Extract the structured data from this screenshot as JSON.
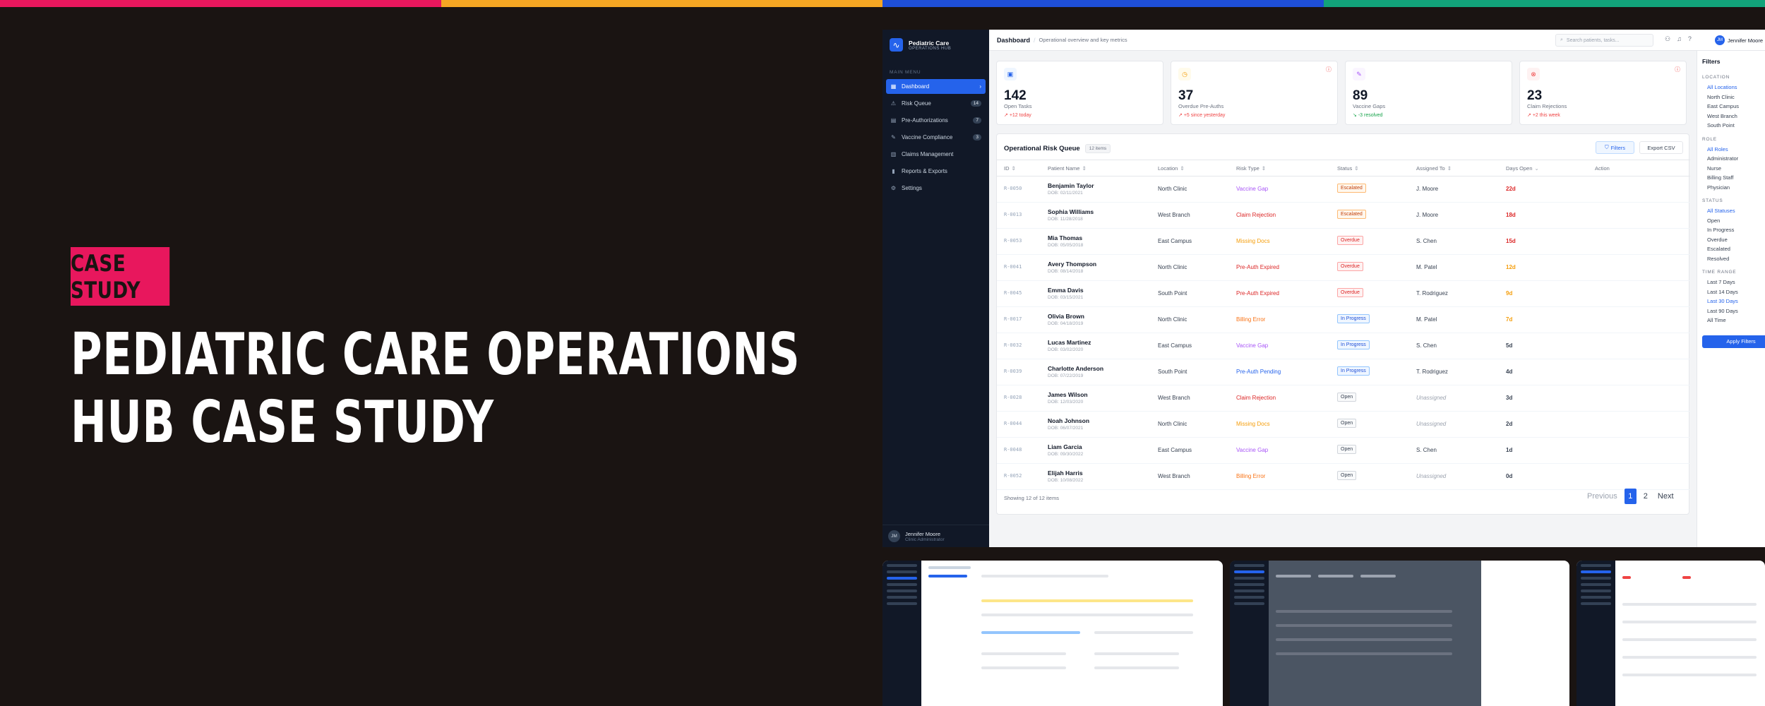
{
  "colors": {
    "stripe1": "#e8175d",
    "stripe2": "#f5a623",
    "stripe3": "#1e4fd8",
    "stripe4": "#12a37a",
    "accent": "#2563eb",
    "bg": "#1a1412"
  },
  "hero": {
    "badge": "CASE STUDY",
    "title_line1": "PEDIATRIC CARE OPERATIONS",
    "title_line2": "HUB CASE STUDY"
  },
  "app": {
    "brand": {
      "name": "Pediatric Care",
      "sub": "OPERATIONS HUB",
      "icon": "pulse-icon"
    },
    "menu_label": "MAIN MENU",
    "nav": [
      {
        "label": "Dashboard",
        "icon": "grid-icon",
        "active": true,
        "count": ""
      },
      {
        "label": "Risk Queue",
        "icon": "warning-icon",
        "active": false,
        "count": "14"
      },
      {
        "label": "Pre-Authorizations",
        "icon": "document-icon",
        "active": false,
        "count": "7"
      },
      {
        "label": "Vaccine Compliance",
        "icon": "syringe-icon",
        "active": false,
        "count": "3"
      },
      {
        "label": "Claims Management",
        "icon": "receipt-icon",
        "active": false,
        "count": ""
      },
      {
        "label": "Reports & Exports",
        "icon": "chart-icon",
        "active": false,
        "count": ""
      },
      {
        "label": "Settings",
        "icon": "gear-icon",
        "active": false,
        "count": ""
      }
    ],
    "user": {
      "initials": "JM",
      "name": "Jennifer Moore",
      "role": "Clinic Administrator"
    },
    "topbar": {
      "title": "Dashboard",
      "subtitle": "Operational overview and key metrics",
      "search_placeholder": "Search patients, tasks...",
      "user_initials": "JM",
      "user_name": "Jennifer Moore"
    },
    "kpis": [
      {
        "value": "142",
        "label": "Open Tasks",
        "delta": "+12 today",
        "icon": "clipboard-icon",
        "icon_color": "#2563eb",
        "icon_bg": "#eff6ff",
        "delta_color": "#ef4444",
        "alert": false
      },
      {
        "value": "37",
        "label": "Overdue Pre-Auths",
        "delta": "+5 since yesterday",
        "icon": "clock-icon",
        "icon_color": "#f59e0b",
        "icon_bg": "#fffbeb",
        "delta_color": "#ef4444",
        "alert": true
      },
      {
        "value": "89",
        "label": "Vaccine Gaps",
        "delta": "-3 resolved",
        "icon": "syringe-icon",
        "icon_color": "#a855f7",
        "icon_bg": "#faf5ff",
        "delta_color": "#16a34a",
        "alert": false
      },
      {
        "value": "23",
        "label": "Claim Rejections",
        "delta": "+2 this week",
        "icon": "close-circle-icon",
        "icon_color": "#ef4444",
        "icon_bg": "#fef2f2",
        "delta_color": "#ef4444",
        "alert": true
      }
    ],
    "queue": {
      "title": "Operational Risk Queue",
      "count": "12 items",
      "filters_label": "Filters",
      "export_label": "Export CSV",
      "headers": [
        "ID",
        "Patient Name",
        "Location",
        "Risk Type",
        "Status",
        "Assigned To",
        "Days Open",
        "Action"
      ],
      "rows": [
        {
          "id": "R-0050",
          "name": "Benjamin Taylor",
          "dob": "DOB: 02/11/2021",
          "location": "North Clinic",
          "risk": "Vaccine Gap",
          "risk_color": "#a855f7",
          "status": "Escalated",
          "status_type": "esc",
          "assigned": "J. Moore",
          "days": "22d",
          "days_color": "#dc2626"
        },
        {
          "id": "R-0013",
          "name": "Sophia Williams",
          "dob": "DOB: 11/28/2018",
          "location": "West Branch",
          "risk": "Claim Rejection",
          "risk_color": "#dc2626",
          "status": "Escalated",
          "status_type": "esc",
          "assigned": "J. Moore",
          "days": "18d",
          "days_color": "#dc2626"
        },
        {
          "id": "R-0053",
          "name": "Mia Thomas",
          "dob": "DOB: 05/05/2018",
          "location": "East Campus",
          "risk": "Missing Docs",
          "risk_color": "#f59e0b",
          "status": "Overdue",
          "status_type": "over",
          "assigned": "S. Chen",
          "days": "15d",
          "days_color": "#dc2626"
        },
        {
          "id": "R-0041",
          "name": "Avery Thompson",
          "dob": "DOB: 08/14/2018",
          "location": "North Clinic",
          "risk": "Pre-Auth Expired",
          "risk_color": "#dc2626",
          "status": "Overdue",
          "status_type": "over",
          "assigned": "M. Patel",
          "days": "12d",
          "days_color": "#f59e0b"
        },
        {
          "id": "R-0045",
          "name": "Emma Davis",
          "dob": "DOB: 03/15/2021",
          "location": "South Point",
          "risk": "Pre-Auth Expired",
          "risk_color": "#dc2626",
          "status": "Overdue",
          "status_type": "over",
          "assigned": "T. Rodriguez",
          "days": "9d",
          "days_color": "#f59e0b"
        },
        {
          "id": "R-0017",
          "name": "Olivia Brown",
          "dob": "DOB: 04/18/2019",
          "location": "North Clinic",
          "risk": "Billing Error",
          "risk_color": "#f97316",
          "status": "In Progress",
          "status_type": "prog",
          "assigned": "M. Patel",
          "days": "7d",
          "days_color": "#f59e0b"
        },
        {
          "id": "R-0032",
          "name": "Lucas Martinez",
          "dob": "DOB: 03/02/2020",
          "location": "East Campus",
          "risk": "Vaccine Gap",
          "risk_color": "#a855f7",
          "status": "In Progress",
          "status_type": "prog",
          "assigned": "S. Chen",
          "days": "5d",
          "days_color": "#374151"
        },
        {
          "id": "R-0039",
          "name": "Charlotte Anderson",
          "dob": "DOB: 07/22/2019",
          "location": "South Point",
          "risk": "Pre-Auth Pending",
          "risk_color": "#2563eb",
          "status": "In Progress",
          "status_type": "prog",
          "assigned": "T. Rodriguez",
          "days": "4d",
          "days_color": "#374151"
        },
        {
          "id": "R-0028",
          "name": "James Wilson",
          "dob": "DOB: 12/03/2020",
          "location": "West Branch",
          "risk": "Claim Rejection",
          "risk_color": "#dc2626",
          "status": "Open",
          "status_type": "open",
          "assigned": "Unassigned",
          "days": "3d",
          "days_color": "#374151"
        },
        {
          "id": "R-0044",
          "name": "Noah Johnson",
          "dob": "DOB: 06/07/2021",
          "location": "North Clinic",
          "risk": "Missing Docs",
          "risk_color": "#f59e0b",
          "status": "Open",
          "status_type": "open",
          "assigned": "Unassigned",
          "days": "2d",
          "days_color": "#374151"
        },
        {
          "id": "R-0048",
          "name": "Liam Garcia",
          "dob": "DOB: 09/30/2022",
          "location": "East Campus",
          "risk": "Vaccine Gap",
          "risk_color": "#a855f7",
          "status": "Open",
          "status_type": "open",
          "assigned": "S. Chen",
          "days": "1d",
          "days_color": "#374151"
        },
        {
          "id": "R-0052",
          "name": "Elijah Harris",
          "dob": "DOB: 10/08/2022",
          "location": "West Branch",
          "risk": "Billing Error",
          "risk_color": "#f97316",
          "status": "Open",
          "status_type": "open",
          "assigned": "Unassigned",
          "days": "0d",
          "days_color": "#374151"
        }
      ],
      "footer": "Showing 12 of 12 items",
      "prev": "Previous",
      "page1": "1",
      "page2": "2",
      "next": "Next"
    },
    "filters": {
      "title": "Filters",
      "sections": [
        {
          "label": "LOCATION",
          "options": [
            "All Locations",
            "North Clinic",
            "East Campus",
            "West Branch",
            "South Point"
          ],
          "selected": 0
        },
        {
          "label": "ROLE",
          "options": [
            "All Roles",
            "Administrator",
            "Nurse",
            "Billing Staff",
            "Physician"
          ],
          "selected": 0
        },
        {
          "label": "STATUS",
          "options": [
            "All Statuses",
            "Open",
            "In Progress",
            "Overdue",
            "Escalated",
            "Resolved"
          ],
          "selected": 0
        },
        {
          "label": "TIME RANGE",
          "options": [
            "Last 7 Days",
            "Last 14 Days",
            "Last 30 Days",
            "Last 90 Days",
            "All Time"
          ],
          "selected": 2
        }
      ],
      "apply_label": "Apply Filters"
    }
  }
}
